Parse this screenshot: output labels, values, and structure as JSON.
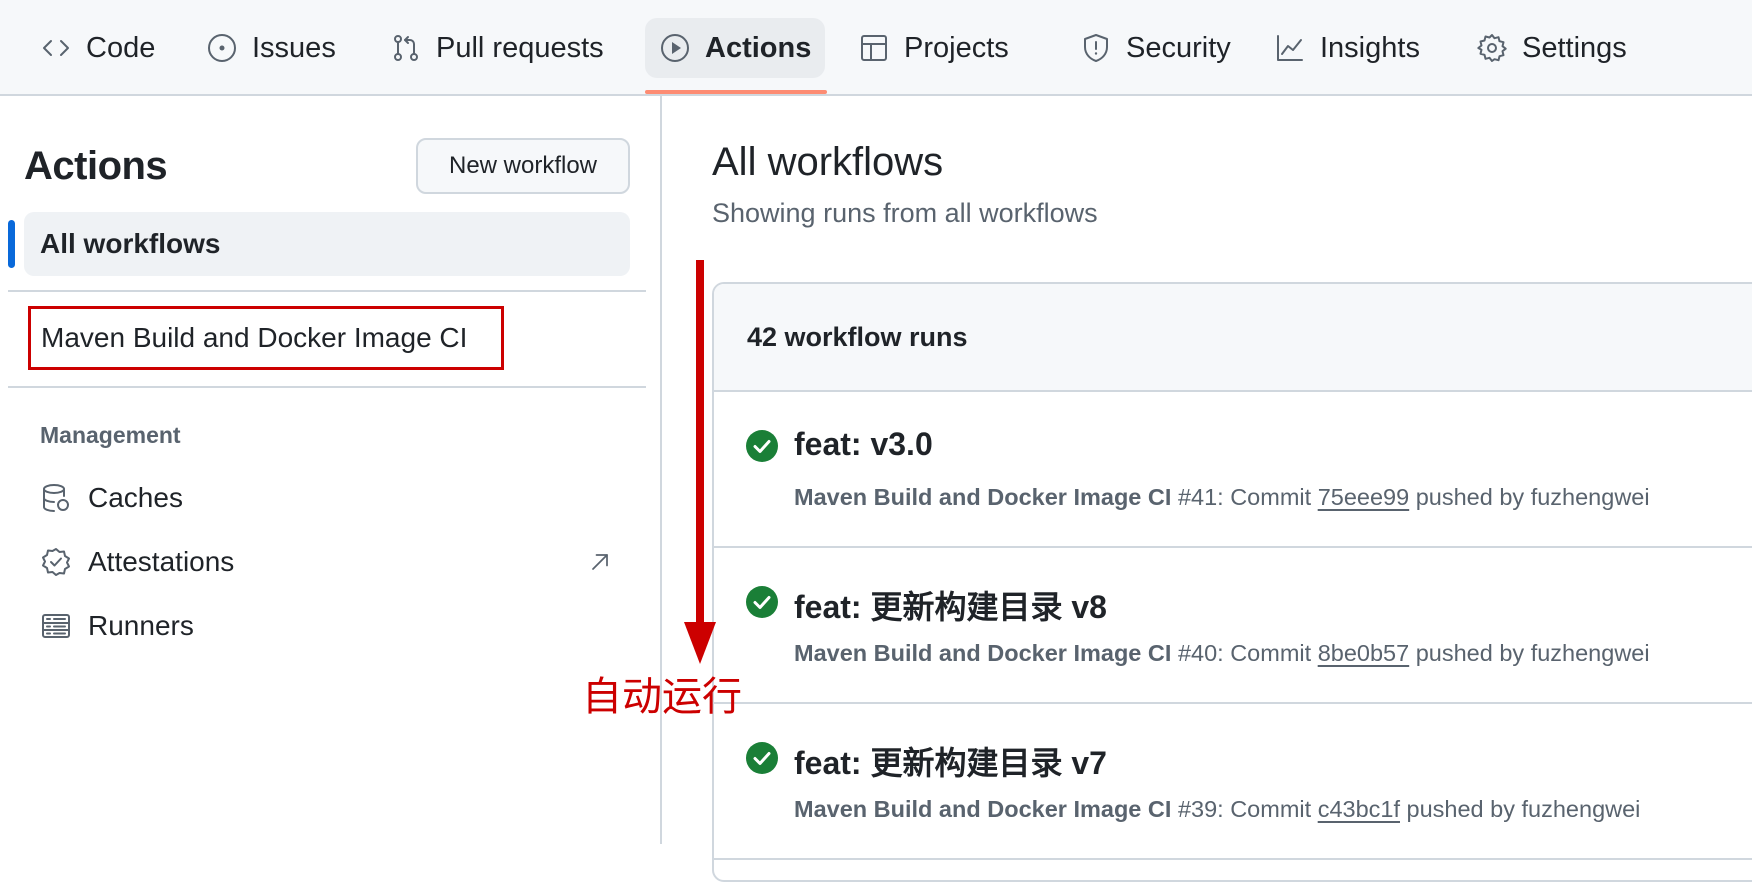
{
  "nav": {
    "tabs": [
      {
        "label": "Code",
        "icon": "code-icon"
      },
      {
        "label": "Issues",
        "icon": "issue-opened-icon"
      },
      {
        "label": "Pull requests",
        "icon": "git-pull-request-icon"
      },
      {
        "label": "Actions",
        "icon": "play-icon",
        "active": true
      },
      {
        "label": "Projects",
        "icon": "table-icon"
      },
      {
        "label": "Security",
        "icon": "shield-icon"
      },
      {
        "label": "Insights",
        "icon": "graph-icon"
      },
      {
        "label": "Settings",
        "icon": "gear-icon"
      }
    ],
    "active_underline_color": "#fd8c73"
  },
  "sidebar": {
    "title": "Actions",
    "new_workflow_label": "New workflow",
    "all_workflows_label": "All workflows",
    "workflow_item": "Maven Build and Docker Image CI",
    "management_label": "Management",
    "management_items": [
      {
        "label": "Caches",
        "icon": "database-icon"
      },
      {
        "label": "Attestations",
        "icon": "verified-icon",
        "external": true
      },
      {
        "label": "Runners",
        "icon": "server-icon"
      }
    ]
  },
  "main": {
    "title": "All workflows",
    "subtitle": "Showing runs from all workflows",
    "runs_count_label": "42 workflow runs",
    "runs": [
      {
        "title": "feat: v3.0",
        "workflow": "Maven Build and Docker Image CI",
        "number": "#41",
        "commit_prefix": ": Commit",
        "sha": "75eee99",
        "pushed_by": "pushed by fuzhengwei",
        "status": "success"
      },
      {
        "title": "feat: 更新构建目录 v8",
        "workflow": "Maven Build and Docker Image CI",
        "number": "#40",
        "commit_prefix": ": Commit",
        "sha": "8be0b57",
        "pushed_by": "pushed by fuzhengwei",
        "status": "success"
      },
      {
        "title": "feat: 更新构建目录 v7",
        "workflow": "Maven Build and Docker Image CI",
        "number": "#39",
        "commit_prefix": ": Commit",
        "sha": "c43bc1f",
        "pushed_by": "pushed by fuzhengwei",
        "status": "success"
      }
    ]
  },
  "annotation": {
    "text": "自动运行",
    "color": "#cc0000"
  },
  "colors": {
    "success": "#1a7f37",
    "accent": "#0969da",
    "highlight_box": "#cc0000"
  }
}
